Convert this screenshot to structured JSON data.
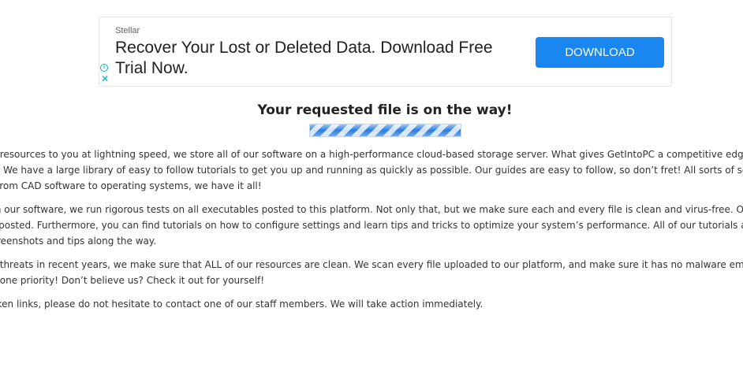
{
  "ad": {
    "brand": "Stellar",
    "headline": "Recover Your Lost or Deleted Data. Download Free Trial Now.",
    "button_label": "DOWNLOAD",
    "info_icon": "i",
    "close_icon": "✕",
    "button_color": "#1a86f0",
    "adchoice_color": "#00aecd"
  },
  "main": {
    "heading": "Your requested file is on the way!",
    "progress_state": "indeterminate",
    "paragraphs": [
      {
        "lines": [
          "our resources to you at lightning speed, we store all of our software on a high-performance cloud-based storage server. What gives GetIntoPC a competitive edge ag",
          "are! We have a large library of easy to follow tutorials to get you up and running as quickly as possible. Our guides are easy to follow, so don’t fret! All sorts of softwa",
          "ng from CAD software to operating systems, we have it all!"
        ]
      },
      {
        "lines": [
          " with our software, we run rigorous tests on all executables posted to this platform. Not only that, but we make sure each and every file is clean and virus-free. Once y",
          "ets posted. Furthermore, you can find tutorials on how to configure settings and learn tips and tricks to optimize your system’s performance. All of our tutorials are s",
          "l screenshots and tips along the way."
        ]
      },
      {
        "lines": [
          "ber threats in recent years, we make sure that ALL of our resources are clean. We scan every file uploaded to our platform, and make sure it has no malware embedd",
          "ber one priority! Don’t believe us? Check it out for yourself!"
        ]
      },
      {
        "lines": [
          "broken links, please do not hesitate to contact one of our staff members. We will take action immediately."
        ]
      }
    ]
  }
}
